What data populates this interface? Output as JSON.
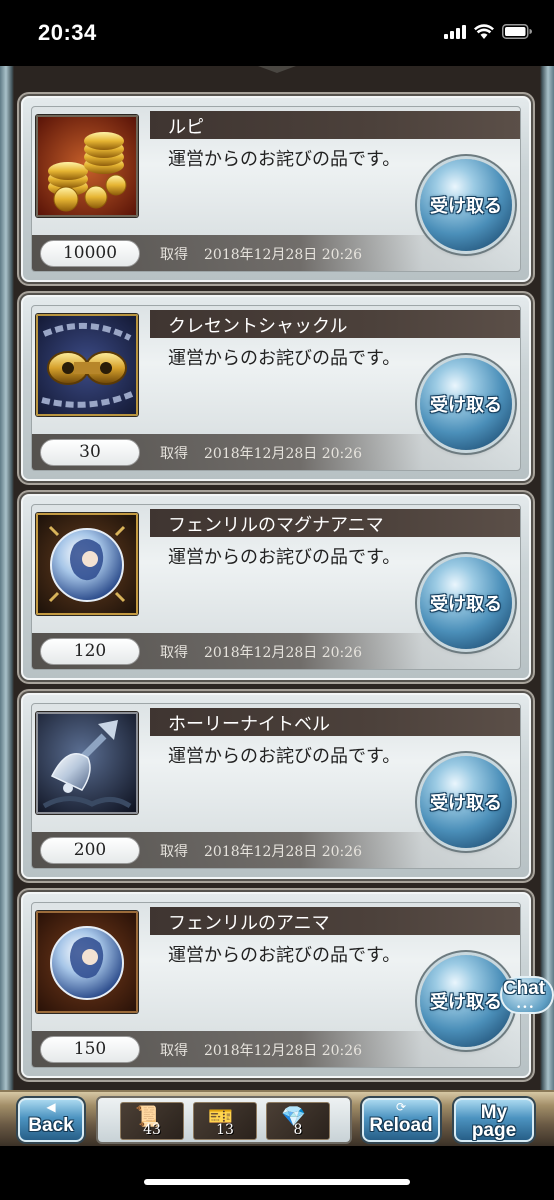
{
  "status_bar": {
    "time": "20:34"
  },
  "gifts": [
    {
      "name": "ルピ",
      "description": "運営からのお詫びの品です。",
      "quantity": "10000",
      "received_label": "取得",
      "date": "2018年12月28日 20:26",
      "button_label": "受け取る",
      "icon": "rupie-coins-icon"
    },
    {
      "name": "クレセントシャックル",
      "description": "運営からのお詫びの品です。",
      "quantity": "30",
      "received_label": "取得",
      "date": "2018年12月28日 20:26",
      "button_label": "受け取る",
      "icon": "crescent-shackle-icon"
    },
    {
      "name": "フェンリルのマグナアニマ",
      "description": "運営からのお詫びの品です。",
      "quantity": "120",
      "received_label": "取得",
      "date": "2018年12月28日 20:26",
      "button_label": "受け取る",
      "icon": "fenrir-omega-anima-icon"
    },
    {
      "name": "ホーリーナイトベル",
      "description": "運営からのお詫びの品です。",
      "quantity": "200",
      "received_label": "取得",
      "date": "2018年12月28日 20:26",
      "button_label": "受け取る",
      "icon": "holy-night-bell-icon"
    },
    {
      "name": "フェンリルのアニマ",
      "description": "運営からのお詫びの品です。",
      "quantity": "150",
      "received_label": "取得",
      "date": "2018年12月28日 20:26",
      "button_label": "受け取る",
      "icon": "fenrir-anima-icon"
    }
  ],
  "chat": {
    "label": "Chat",
    "dots": "•••"
  },
  "nav": {
    "back_label": "Back",
    "reload_label": "Reload",
    "mypage_line1": "My",
    "mypage_line2": "page",
    "bags": [
      {
        "count": "43",
        "icon": "scroll-icon"
      },
      {
        "count": "13",
        "icon": "ticket-icon"
      },
      {
        "count": "8",
        "icon": "crystal-icon"
      }
    ]
  },
  "colors": {
    "accent_blue": "#4b8fb9",
    "title_bar": "#3f3531",
    "card_bg": "#e4eaec"
  }
}
